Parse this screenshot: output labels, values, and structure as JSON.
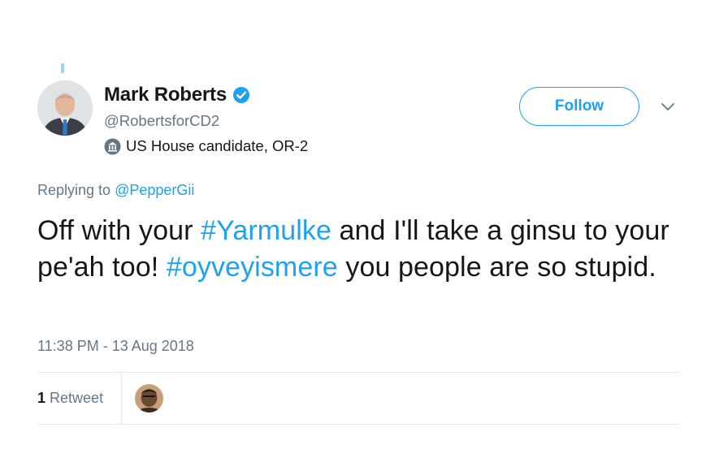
{
  "user": {
    "name": "Mark Roberts",
    "handle": "@RobertsforCD2",
    "label": "US House candidate, OR-2",
    "avatar_icon": "profile-photo",
    "verified_icon": "verified-badge-icon"
  },
  "follow_label": "Follow",
  "reply": {
    "prefix": "Replying to ",
    "mention": "@PepperGii"
  },
  "tweet": {
    "t1": "Off with your ",
    "h1": "#Yarmulke",
    "t2": " and I'll take a ginsu to your pe'ah too! ",
    "h2": "#oyveyismere",
    "t3": " you people are so stupid."
  },
  "timestamp": "11:38 PM - 13 Aug 2018",
  "stats": {
    "retweet_count": "1",
    "retweet_label": "Retweet"
  },
  "colors": {
    "accent": "#1da1f2",
    "secondary_text": "#657786",
    "primary_text": "#14171a",
    "divider": "#e1e8ed"
  }
}
